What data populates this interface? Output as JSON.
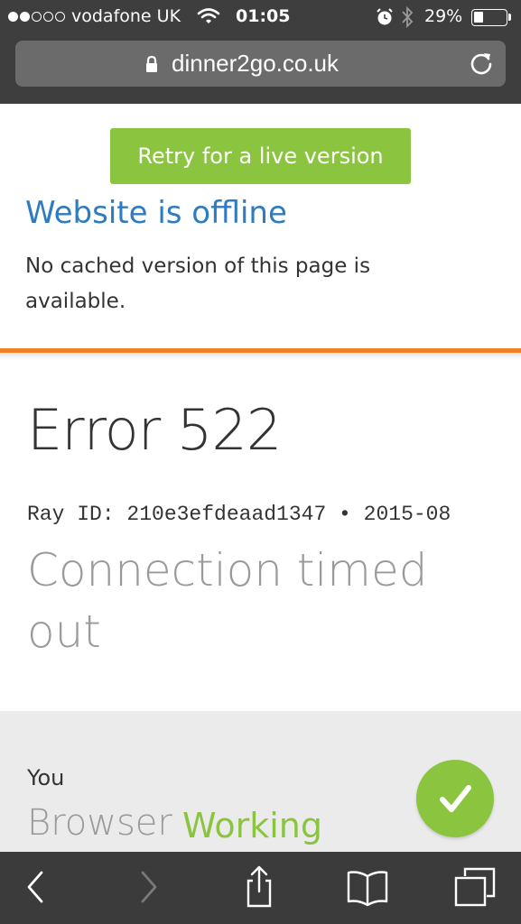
{
  "status_bar": {
    "carrier": "vodafone UK",
    "time": "01:05",
    "battery_percent": "29%",
    "battery_level": 0.29,
    "signal_bars_filled": 2,
    "signal_bars_total": 5
  },
  "browser": {
    "url": "dinner2go.co.uk"
  },
  "notice": {
    "retry_label": "Retry for a live version",
    "title": "Website is offline",
    "message": "No cached version of this page is available."
  },
  "error": {
    "code": "Error 522",
    "ray_line": "Ray ID: 210e3efdeaad1347 • 2015-08",
    "title": "Connection timed out"
  },
  "diagnostic": {
    "label": "You",
    "name": "Browser",
    "status": "Working"
  },
  "colors": {
    "accent_green": "#8bc53f",
    "link_blue": "#2f7bbf",
    "divider_orange": "#f38020"
  }
}
